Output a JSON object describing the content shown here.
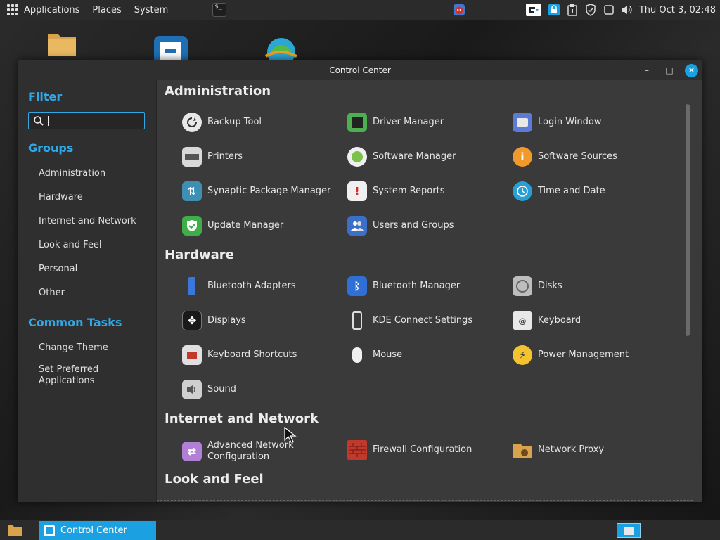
{
  "top_panel": {
    "menus": [
      "Applications",
      "Places",
      "System"
    ],
    "clock": "Thu Oct  3, 02:48"
  },
  "window": {
    "title": "Control Center",
    "minimize_glyph": "–",
    "maximize_glyph": "□",
    "close_glyph": "✕"
  },
  "sidebar": {
    "filter_heading": "Filter",
    "search_value": "",
    "groups_heading": "Groups",
    "groups": [
      "Administration",
      "Hardware",
      "Internet and Network",
      "Look and Feel",
      "Personal",
      "Other"
    ],
    "tasks_heading": "Common Tasks",
    "tasks": [
      "Change Theme",
      "Set Preferred Applications"
    ]
  },
  "sections": {
    "administration": {
      "title": "Administration",
      "items": [
        "Backup Tool",
        "Driver Manager",
        "Login Window",
        "Printers",
        "Software Manager",
        "Software Sources",
        "Synaptic Package Manager",
        "System Reports",
        "Time and Date",
        "Update Manager",
        "Users and Groups"
      ]
    },
    "hardware": {
      "title": "Hardware",
      "items": [
        "Bluetooth Adapters",
        "Bluetooth Manager",
        "Disks",
        "Displays",
        "KDE Connect Settings",
        "Keyboard",
        "Keyboard Shortcuts",
        "Mouse",
        "Power Management",
        "Sound"
      ]
    },
    "internet": {
      "title": "Internet and Network",
      "items": [
        "Advanced Network Configuration",
        "Firewall Configuration",
        "Network Proxy"
      ]
    },
    "look": {
      "title": "Look and Feel"
    }
  },
  "taskbar": {
    "active_window": "Control Center"
  },
  "colors": {
    "accent": "#1ba1e2",
    "sidebar_heading": "#2ea8e6",
    "window_bg": "#3a3a3a",
    "panel_bg": "#2b2b2b"
  }
}
